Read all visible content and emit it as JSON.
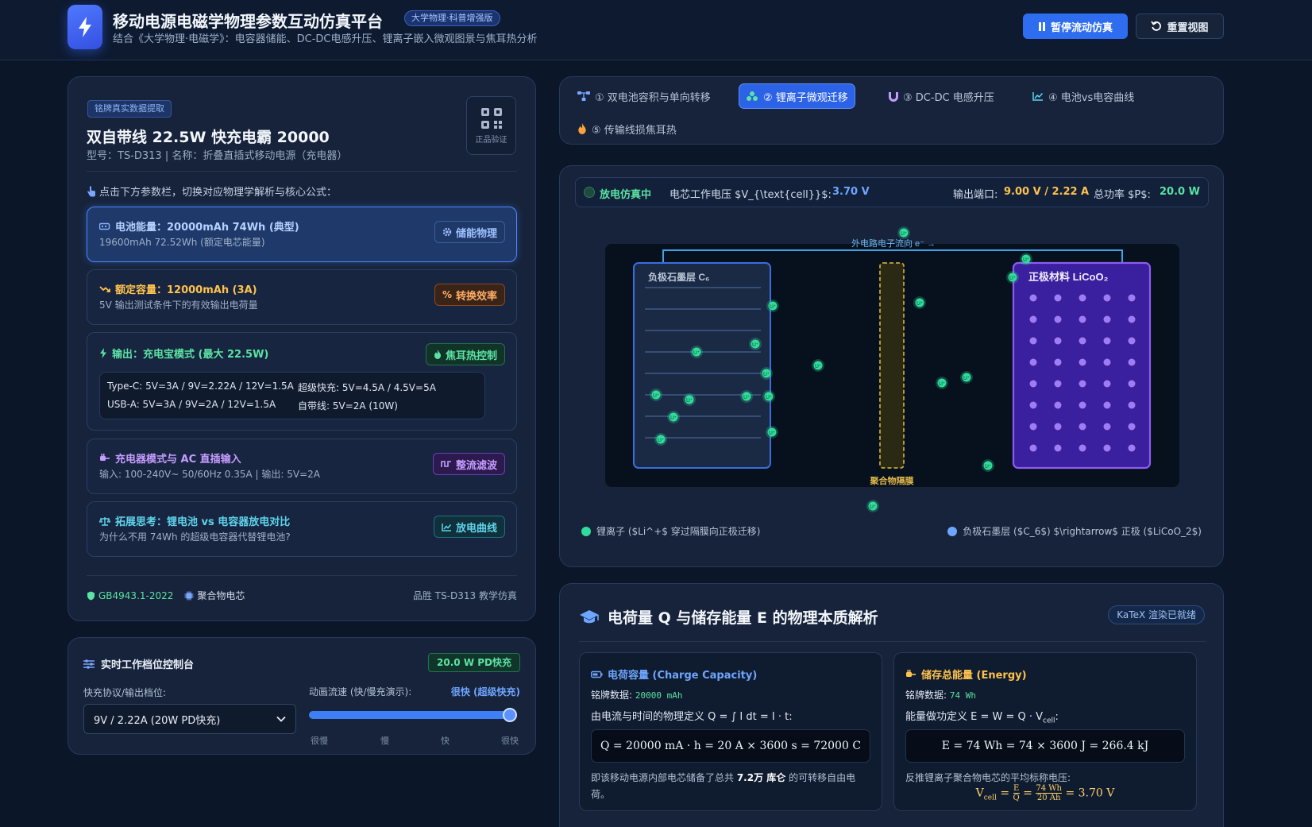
{
  "header": {
    "title": "移动电源电磁学物理参数互动仿真平台",
    "edition_badge": "大学物理·科普增强版",
    "subtitle": "结合《大学物理·电磁学》：电容器储能、DC-DC电感升压、锂离子嵌入微观图景与焦耳热分析",
    "pause_button": "暂停流动仿真",
    "reset_button": "重置视图"
  },
  "product": {
    "tag": "铭牌真实数据提取",
    "name": "双自带线 22.5W 快充电霸 20000",
    "model_line": "型号：TS-D313 | 名称：折叠直插式移动电源（充电器）",
    "qr_label": "正品验证",
    "hint": "点击下方参数栏，切换对应物理学解析与核心公式："
  },
  "params": [
    {
      "title": "电池能量：20000mAh 74Wh (典型)",
      "sub": "19600mAh 72.52Wh (额定电芯能量)",
      "chip": "储能物理"
    },
    {
      "title": "额定容量：12000mAh (3A)",
      "sub": "5V 输出测试条件下的有效输出电荷量",
      "chip": "转换效率"
    },
    {
      "title": "输出：充电宝模式 (最大 22.5W)",
      "chip": "焦耳热控制",
      "outputs": {
        "typec": "Type-C: 5V=3A / 9V=2.22A / 12V=1.5A",
        "super": "超级快充: 5V=4.5A / 4.5V=5A",
        "usba": "USB-A: 5V=3A / 9V=2A / 12V=1.5A",
        "cable": "自带线: 5V=2A (10W)"
      }
    },
    {
      "title": "充电器模式与 AC 直插输入",
      "sub": "输入: 100-240V~ 50/60Hz 0.35A | 输出: 5V=2A",
      "chip": "整流滤波"
    },
    {
      "title": "拓展思考：锂电池 vs 电容器放电对比",
      "sub": "为什么不用 74Wh 的超级电容器代替锂电池?",
      "chip": "放电曲线"
    }
  ],
  "product_footer": {
    "standard": "GB4943.1-2022",
    "cell": "聚合物电芯",
    "brand": "品胜 TS-D313 教学仿真"
  },
  "control": {
    "title": "实时工作档位控制台",
    "badge": "20.0 W PD快充",
    "protocol_label": "快充协议/输出档位:",
    "protocol_value": "9V / 2.22A (20W PD快充)",
    "speed_label": "动画流速 (快/慢充演示):",
    "speed_value": "很快 (超级快充)",
    "speed_level": 1.0,
    "ticks": [
      "很慢",
      "慢",
      "快",
      "很快"
    ]
  },
  "tabs": [
    {
      "label": "① 双电池容积与单向转移"
    },
    {
      "label": "② 锂离子微观迁移"
    },
    {
      "label": "③ DC-DC 电感升压"
    },
    {
      "label": "④ 电池vs电容曲线"
    },
    {
      "label": "⑤ 传输线损焦耳热"
    }
  ],
  "simulation": {
    "status": "放电仿真中",
    "cell_voltage_label": "电芯工作电压 $V_{\\text{cell}}$:",
    "cell_voltage_value": "3.70 V",
    "output_label": "输出端口:",
    "output_value": "9.00 V / 2.22 A",
    "power_label": "总功率 $P$:",
    "power_value": "20.0 W",
    "external_flow": "外电路电子流向 e⁻ →",
    "anode_label": "负极石墨层 C₆",
    "cathode_label": "正极材料 LiCoO₂",
    "separator_label": "聚合物隔膜",
    "ion_label": "Li⁺",
    "legend_ion": "锂离子 ($Li^+$ 穿过隔膜向正极迁移)",
    "legend_direction": "负极石墨层 ($C_6$) $\\rightarrow$ 正极 ($LiCoO_2$)"
  },
  "analysis": {
    "title": "电荷量 Q 与储存能量 E 的物理本质解析",
    "katex_badge": "KaTeX 渲染已就绪",
    "charge": {
      "title": "电荷容量 (Charge Capacity)",
      "nameplate_label": "铭牌数据:",
      "nameplate_value": "20000 mAh",
      "definition": "由电流与时间的物理定义 Q = ∫ I dt = I · t:",
      "formula": "Q = 20000 mA · h = 20 A × 3600 s = 72000 C",
      "note_prefix": "即该移动电源内部电芯储备了总共 ",
      "note_bold": "7.2万 库仑",
      "note_suffix": " 的可转移自由电荷。"
    },
    "energy": {
      "title": "储存总能量 (Energy)",
      "nameplate_label": "铭牌数据:",
      "nameplate_value": "74 Wh",
      "definition": "能量做功定义 E = W = Q · V",
      "definition_sub": "cell",
      "definition_end": ":",
      "formula": "E = 74 Wh = 74 × 3600 J = 266.4 kJ",
      "note": "反推锂离子聚合物电芯的平均标称电压:",
      "result_lhs": "V",
      "result_lhs_sub": "cell",
      "result_num1": "E",
      "result_den1": "Q",
      "result_num2": "74 Wh",
      "result_den2": "20 Ah",
      "result_value": "= 3.70 V"
    }
  }
}
